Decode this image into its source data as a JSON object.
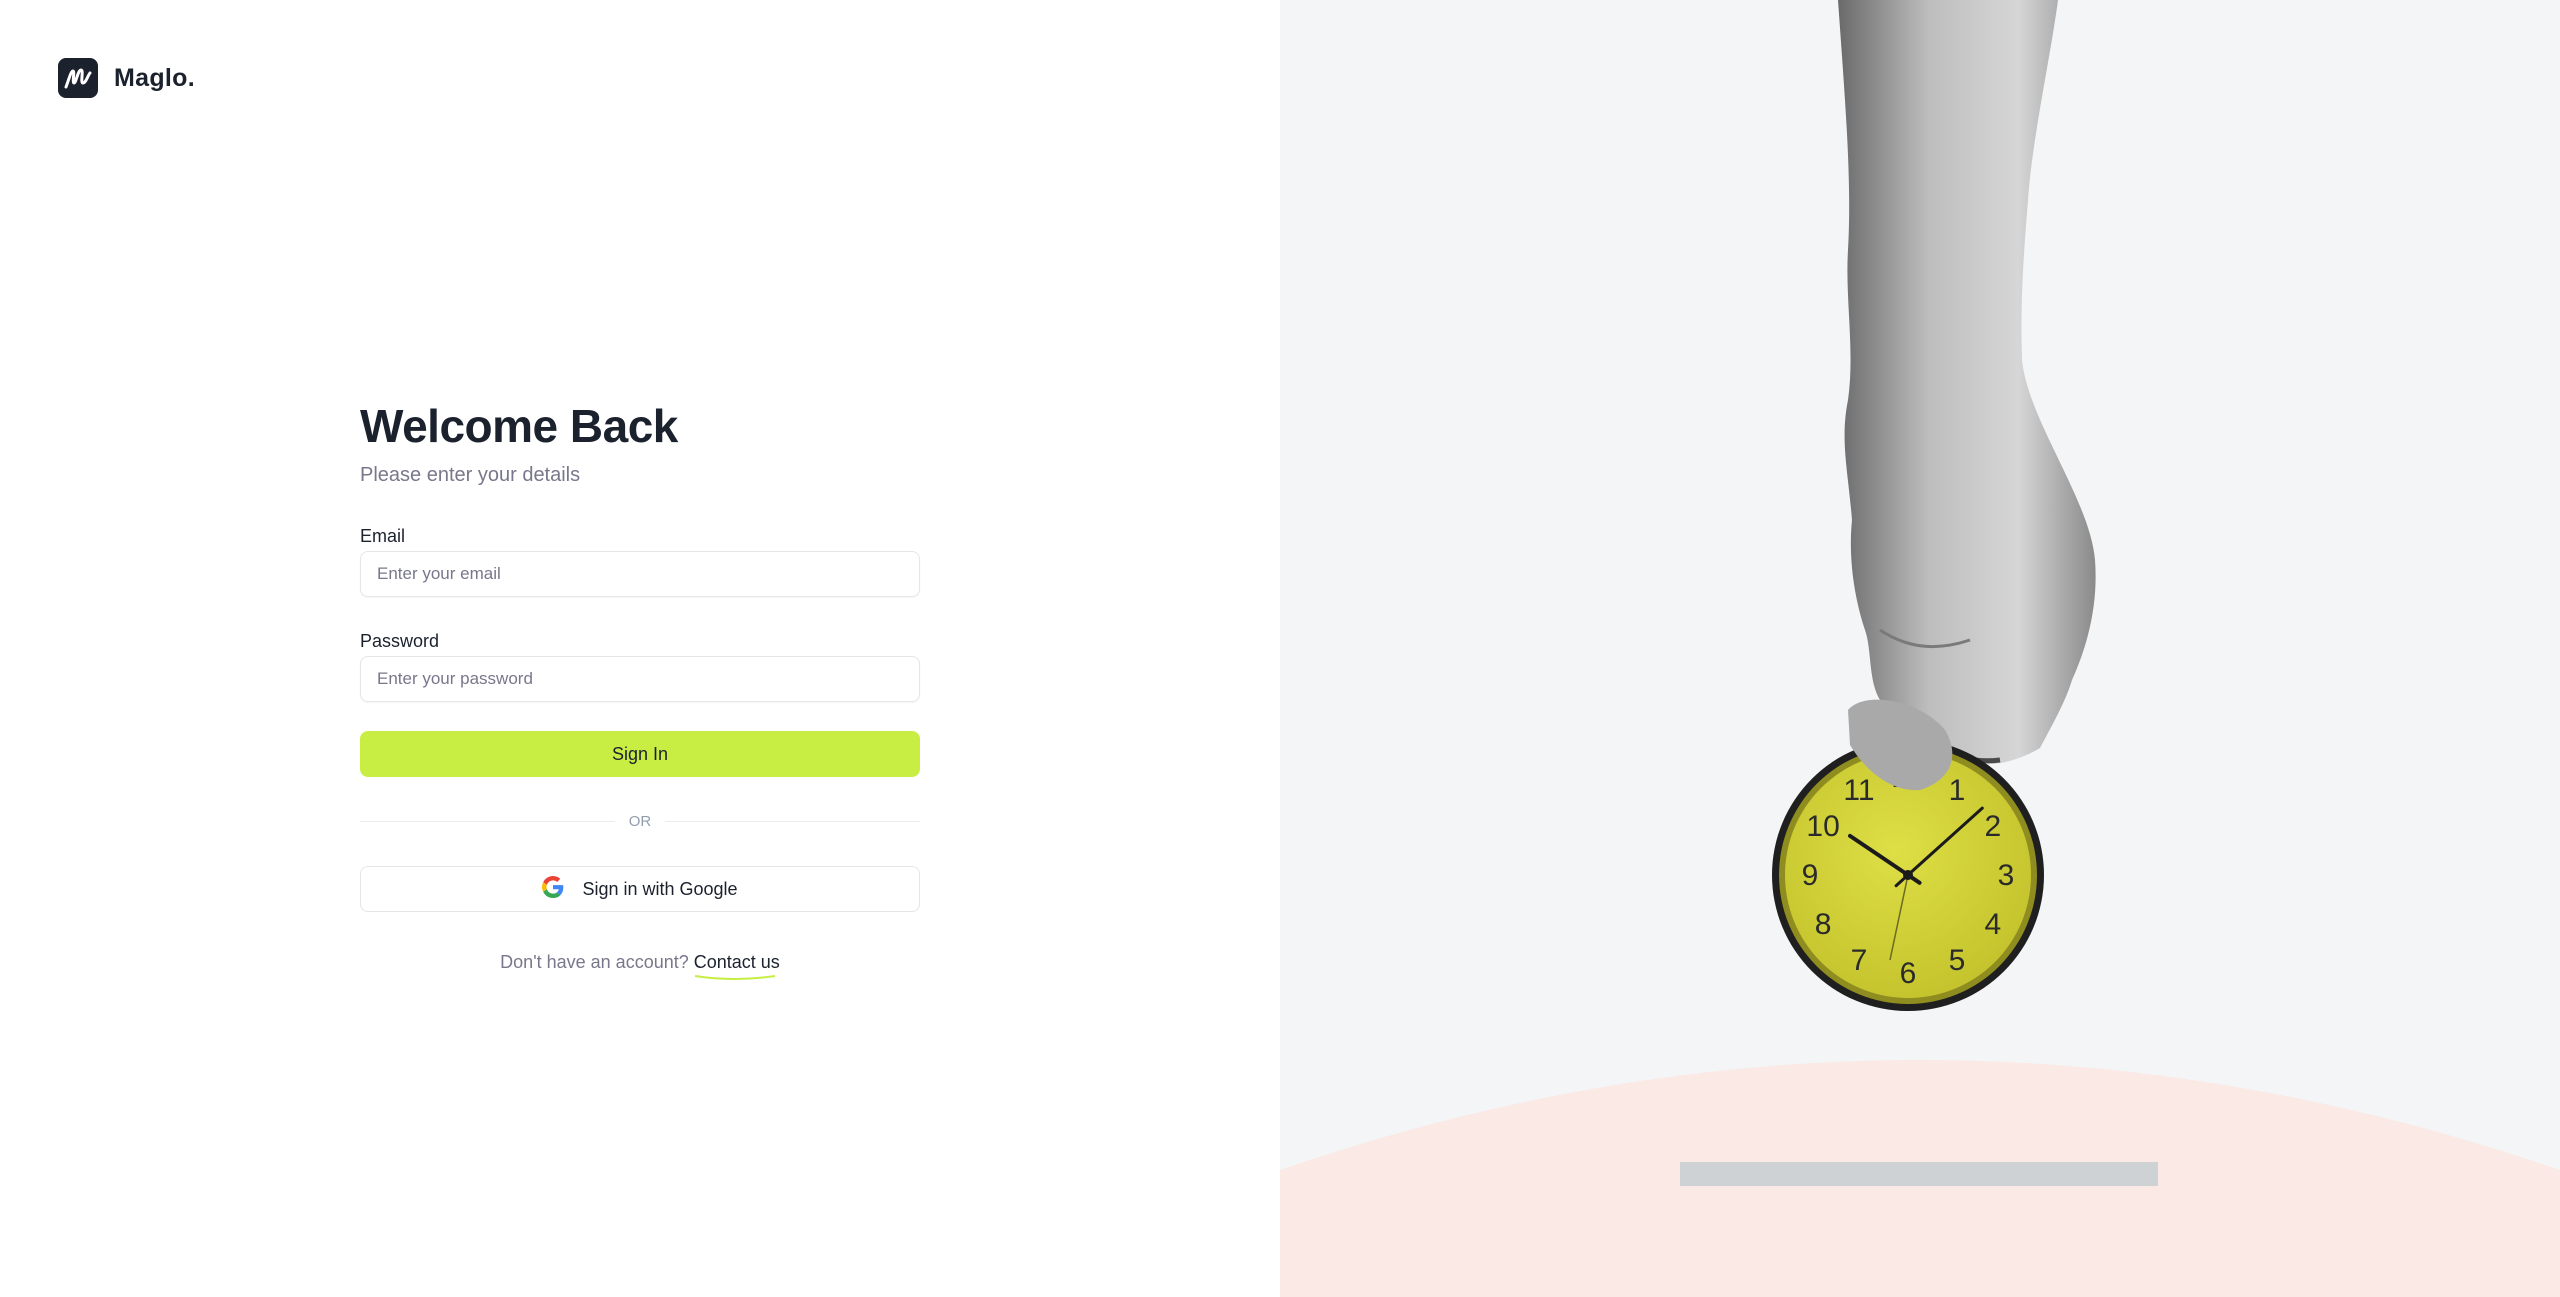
{
  "brand": {
    "name": "Maglo.",
    "logo_icon": "maglo-logo-icon"
  },
  "form": {
    "title": "Welcome Back",
    "subtitle": "Please enter your details",
    "email": {
      "label": "Email",
      "placeholder": "Enter your email",
      "value": ""
    },
    "password": {
      "label": "Password",
      "placeholder": "Enter your password",
      "value": ""
    },
    "signin_label": "Sign In",
    "divider_text": "OR",
    "google_label": "Sign in with Google",
    "google_icon": "google-icon",
    "signup_prompt": "Don't have an account?",
    "signup_link": "Contact us"
  },
  "illustration": {
    "clock_numbers": [
      "12",
      "1",
      "2",
      "3",
      "4",
      "5",
      "6",
      "7",
      "8",
      "9",
      "10",
      "11"
    ],
    "time_hours": 10,
    "time_minutes": 8
  },
  "colors": {
    "accent": "#c8ee44",
    "text": "#1b212d",
    "muted": "#78778b",
    "clock_face": "#d4d233",
    "right_bg": "#f4f5f6",
    "mound": "#fbe9e6"
  }
}
